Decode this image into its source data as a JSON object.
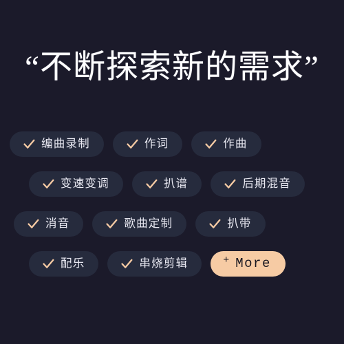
{
  "theme": {
    "background": "#1b1a2a",
    "tag_background": "#262b3d",
    "tag_text": "#e9e9f2",
    "accent": "#f6cba4",
    "accent_text": "#16151f",
    "headline_color": "#fdfdff"
  },
  "headline": {
    "text": "“不断探索新的需求”"
  },
  "tag_rows": [
    {
      "tags": [
        {
          "icon": "check-icon",
          "label": "编曲录制"
        },
        {
          "icon": "check-icon",
          "label": "作词"
        },
        {
          "icon": "check-icon",
          "label": "作曲"
        }
      ]
    },
    {
      "tags": [
        {
          "icon": "check-icon",
          "label": "变速变调"
        },
        {
          "icon": "check-icon",
          "label": "扒谱"
        },
        {
          "icon": "check-icon",
          "label": "后期混音"
        }
      ]
    },
    {
      "tags": [
        {
          "icon": "check-icon",
          "label": "消音"
        },
        {
          "icon": "check-icon",
          "label": "歌曲定制"
        },
        {
          "icon": "check-icon",
          "label": "扒带"
        }
      ]
    },
    {
      "tags": [
        {
          "icon": "check-icon",
          "label": "配乐"
        },
        {
          "icon": "check-icon",
          "label": "串烧剪辑"
        }
      ]
    }
  ],
  "more_button": {
    "plus": "+",
    "label": "More",
    "icon": "plus-icon"
  }
}
